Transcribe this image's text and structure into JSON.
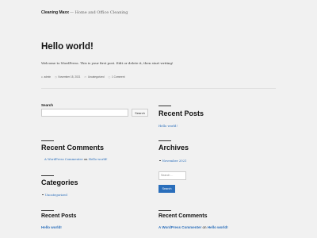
{
  "site": {
    "title": "Cleaning Maxx",
    "separator": "—",
    "description": "Home and Office Cleaning"
  },
  "post": {
    "title": "Hello world!",
    "body": "Welcome to WordPress. This is your first post. Edit or delete it, then start writing!",
    "meta": {
      "author": "admin",
      "date": "November 15, 2021",
      "category": "Uncategorized",
      "comments": "1 Comment"
    }
  },
  "widgets": {
    "search": {
      "label": "Search",
      "button": "Search",
      "value": ""
    },
    "recent_posts_1": {
      "title": "Recent Posts",
      "items": [
        "Hello world!"
      ]
    },
    "recent_comments_1": {
      "title": "Recent Comments",
      "author": "A WordPress Commenter",
      "on": "on",
      "post": "Hello world!"
    },
    "archives": {
      "title": "Archives",
      "items": [
        "November 2021"
      ]
    },
    "search_2": {
      "placeholder": "Search ...",
      "button": "Search"
    },
    "categories": {
      "title": "Categories",
      "items": [
        "Uncategorized"
      ]
    },
    "recent_posts_2": {
      "title": "Recent Posts",
      "items": [
        "Hello world!"
      ]
    },
    "recent_comments_2": {
      "title": "Recent Comments",
      "author": "A WordPress Commenter",
      "on": "on",
      "post": "Hello world!"
    }
  }
}
